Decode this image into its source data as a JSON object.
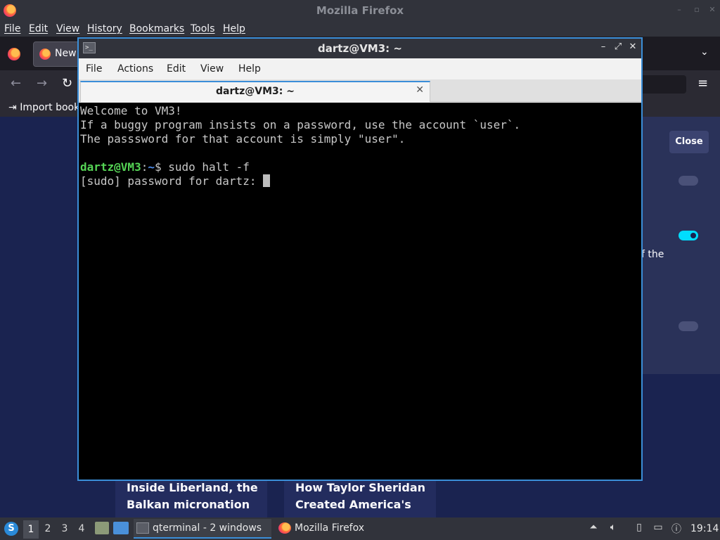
{
  "firefox": {
    "window_title": "Mozilla Firefox",
    "menu": [
      {
        "label": "File"
      },
      {
        "label": "Edit"
      },
      {
        "label": "View"
      },
      {
        "label": "History"
      },
      {
        "label": "Bookmarks"
      },
      {
        "label": "Tools"
      },
      {
        "label": "Help"
      }
    ],
    "tab_label": "New",
    "import_bookmarks": "Import book",
    "close_button": "Close",
    "panel_text_fragment": "f the",
    "stories": [
      {
        "title": "Inside Liberland, the Balkan micronation"
      },
      {
        "title": "How Taylor Sheridan Created America's"
      }
    ]
  },
  "terminal": {
    "window_title": "dartz@VM3: ~",
    "tab_title": "dartz@VM3: ~",
    "menu": [
      {
        "label": "File"
      },
      {
        "label": "Actions"
      },
      {
        "label": "Edit"
      },
      {
        "label": "View"
      },
      {
        "label": "Help"
      }
    ],
    "output_lines": [
      "Welcome to VM3!",
      "If a buggy program insists on a password, use the account `user`.",
      "The passsword for that account is simply \"user\"."
    ],
    "prompt": {
      "user_host": "dartz@VM3",
      "separator": ":",
      "path": "~",
      "symbol": "$ ",
      "command": "sudo halt -f"
    },
    "sudo_prompt": "[sudo] password for dartz: "
  },
  "taskbar": {
    "workspaces": [
      "1",
      "2",
      "3",
      "4"
    ],
    "active_workspace": "1",
    "tasks": [
      {
        "label": "qterminal - 2 windows",
        "icon": "terminal-icon"
      },
      {
        "label": "Mozilla Firefox",
        "icon": "firefox-icon"
      }
    ],
    "clock": "19:14"
  },
  "colors": {
    "accent": "#3b8ed8",
    "terminal_bg": "#000000",
    "prompt_user": "#55d455",
    "prompt_path": "#4f8fef",
    "firefox_content_bg": "#1a2350",
    "toggle_on": "#00ddff"
  }
}
